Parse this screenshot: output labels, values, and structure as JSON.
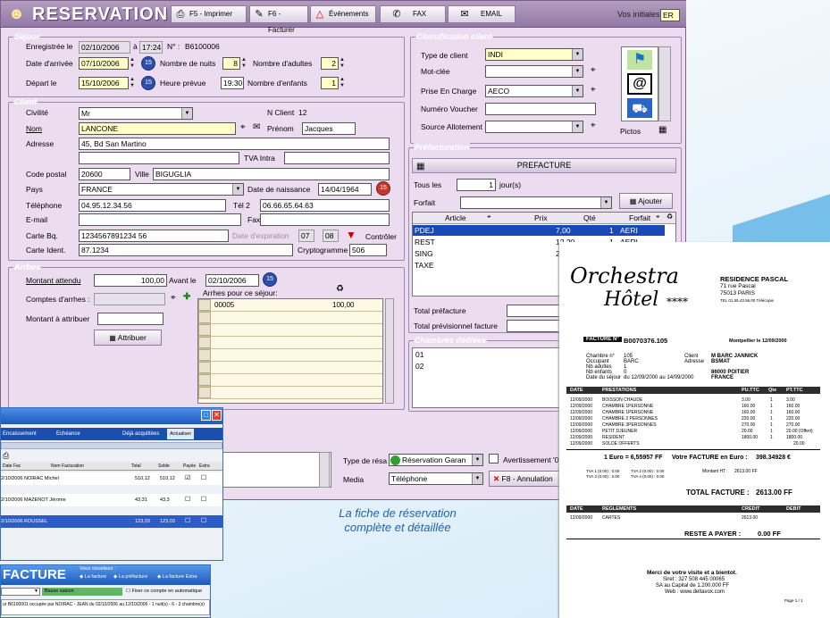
{
  "window": {
    "title": "RESERVATION",
    "toolbar": {
      "print": "F5 - Imprimer",
      "invoice": "F6 - Facturer",
      "events": "Événements",
      "fax": "FAX",
      "email": "EMAIL",
      "initials_label": "Vos initiales",
      "initials_value": "ER"
    }
  },
  "sejour": {
    "title": "Séjour",
    "recorded_label": "Enregistrée le",
    "recorded_date": "02/10/2006",
    "at": "à",
    "recorded_time": "17:24",
    "num_label": "N° :",
    "num_value": "B6100006",
    "arrival_label": "Date d'arrivée",
    "arrival_date": "07/10/2006",
    "nights_label": "Nombre de nuits",
    "nights": "8",
    "adults_label": "Nombre d'adultes",
    "adults": "2",
    "departure_label": "Départ le",
    "departure_date": "15/10/2006",
    "time_label": "Heure prévue",
    "time_value": "19:30",
    "children_label": "Nombre d'enfants",
    "children": "1"
  },
  "client": {
    "title": "Client",
    "civility_label": "Civilité",
    "civility": "Mr",
    "client_no_label": "N Client",
    "client_no": "12",
    "name_label": "Nom",
    "name": "LANCONE",
    "firstname_label": "Prénom",
    "firstname": "Jacques",
    "address_label": "Adresse",
    "address": "45, Bd San Martino",
    "vat_label": "TVA Intra",
    "postal_label": "Code postal",
    "postal": "20600",
    "city_label": "Ville",
    "city": "BIGUGLIA",
    "country_label": "Pays",
    "country": "FRANCE",
    "birth_label": "Date de naissance",
    "birth": "14/04/1964",
    "phone_label": "Téléphone",
    "phone": "04.95.12.34.56",
    "tel2_label": "Tél 2",
    "tel2": "06.66.65.64.63",
    "email_label": "E-mail",
    "fax_label": "Fax",
    "card_label": "Carte Bq.",
    "card": "1234567891234 56",
    "expiry_label": "Date d'expiration",
    "expiry_m": "07",
    "expiry_y": "08",
    "control": "Contrôler",
    "id_label": "Carte Ident.",
    "id": "87.1234",
    "crypto_label": "Cryptogramme",
    "crypto": "506"
  },
  "arrhes": {
    "title": "Arrhes",
    "expected_label": "Montant attendu",
    "expected": "100,00",
    "before_label": "Avant le",
    "before_date": "02/10/2006",
    "accounts_label": "Comptes d'arrhes :",
    "stay_label": "Arrhes pour ce séjour:",
    "grid": [
      {
        "ref": "00005",
        "amount": "100,00"
      }
    ],
    "assign_label": "Montant à attribuer",
    "assign_button": "Attribuer"
  },
  "classification": {
    "title": "Classification client",
    "type_label": "Type de client",
    "type": "INDI",
    "keyword_label": "Mot-clée",
    "pec_label": "Prise En Charge",
    "pec": "AECO",
    "voucher_label": "Numéro Voucher",
    "source_label": "Source Allotement",
    "pictos_label": "Pictos"
  },
  "prefacturation": {
    "title": "Préfacturation",
    "header": "PREFACTURE",
    "all_label": "Tous les",
    "every": "1",
    "unit": "jour(s)",
    "package_label": "Forfait",
    "add_button": "Ajouter",
    "columns": [
      "Article",
      "Prix",
      "Qté",
      "Forfait"
    ],
    "rows": [
      {
        "article": "PDEJ",
        "price": "7,00",
        "qty": "1",
        "forfait": "AERI"
      },
      {
        "article": "REST",
        "price": "12,20",
        "qty": "1",
        "forfait": "AERI"
      },
      {
        "article": "SING",
        "price": "2",
        "qty": "",
        "forfait": ""
      },
      {
        "article": "TAXE",
        "price": "",
        "qty": "",
        "forfait": ""
      }
    ],
    "total_label": "Total préfacture",
    "forecast_label": "Total prévisionnel facture"
  },
  "rooms": {
    "title": "Chambres dédiées",
    "list": [
      "01",
      "02"
    ]
  },
  "bottom": {
    "type_label": "Type de résa",
    "type_value": "Réservation Garan",
    "notice": "Avertissement '0",
    "media_label": "Media",
    "media_value": "Téléphone",
    "cancel": "F8 - Annulation"
  },
  "caption": {
    "line1": "La fiche de réservation",
    "line2": "complète et détaillée"
  },
  "invoice": {
    "logo1": "Orchestra",
    "logo2": "Hôtel",
    "stars": "****",
    "hotel": "RESIDENCE PASCAL",
    "street": "71 rue Pascal",
    "city": "75013 PARIS",
    "tel": "TEL 01.55.43.56.00 Télécopie",
    "facture_label": "FACTURE N°",
    "facture_no": "B0070376.105",
    "place_date": "Montpellier le 12/09/2000",
    "room_label": "Chambre n°",
    "room": "105",
    "occupant_label": "Occupant",
    "occupant": "BARC",
    "adults_label": "Nb adultes",
    "adults": "1",
    "children_label": "Nb enfants",
    "children": "0",
    "stay_label": "Date du séjour",
    "stay": "du 12/09/2000 au 14/09/2000",
    "client_label": "Client",
    "client": "M BARC JANNICK",
    "address_label": "Adresse",
    "address": "BSMAT",
    "address2": "86000 POITIER",
    "address3": "FRANCE",
    "cols": [
      "DATE",
      "PRESTATIONS",
      "PU.TTC",
      "Qte",
      "PT.TTC"
    ],
    "lines": [
      {
        "date": "12/09/2000",
        "label": "BOISSON CHAUDE",
        "pu": "3.00",
        "qte": "1",
        "pt": "3.00"
      },
      {
        "date": "12/09/2000",
        "label": "CHAMBRE 1PERSONNE",
        "pu": "160.00",
        "qte": "1",
        "pt": "160.00"
      },
      {
        "date": "12/09/2000",
        "label": "CHAMBRE 1PERSONNE",
        "pu": "160.00",
        "qte": "1",
        "pt": "160.00"
      },
      {
        "date": "12/09/2000",
        "label": "CHAMBRE 2 PERSONNES",
        "pu": "220.00",
        "qte": "1",
        "pt": "220.00"
      },
      {
        "date": "12/09/2000",
        "label": "CHAMBRE 3PERSONNES",
        "pu": "270.00",
        "qte": "1",
        "pt": "270.00"
      },
      {
        "date": "12/09/2000",
        "label": "PETIT DJEUNER",
        "pu": "20.00",
        "qte": "1",
        "pt": "20.00 (Offert)"
      },
      {
        "date": "12/09/2000",
        "label": "RESIDENT",
        "pu": "1800.00",
        "qte": "1",
        "pt": "1800.00"
      },
      {
        "date": "12/09/2000",
        "label": "SOLDE OFFERTS",
        "pu": "",
        "qte": "",
        "pt": "20.00"
      }
    ],
    "euro_rate": "1 Euro = 6,55957 FF",
    "euro_label": "Votre FACTURE en Euro :",
    "euro_total": "398.34928 €",
    "tva1": "TVA 1 (0.00) : 0.00",
    "tva2": "TVA 2 (0.00) : 0.00",
    "tva3": "TVA 3 (0.00) : 0.00",
    "tva4": "TVA 4 (0.00) : 0.00",
    "ht_label": "Montant HT :",
    "ht": "2613.00 FF",
    "total_label": "TOTAL FACTURE :",
    "total": "2613.00 FF",
    "reg_cols": [
      "DATE",
      "REGLEMENTS",
      "CREDIT",
      "DEBIT"
    ],
    "reg_date": "12/09/2000",
    "reg_label": "CARTES",
    "reg_credit": "2613.00",
    "rest_label": "RESTE A PAYER :",
    "rest": "0.00 FF",
    "thanks": "Merci de votre visite et a bientot.",
    "siret": "Siret : 327 508 445 00065",
    "capital": "SA au Capital de 1.200.000 FF",
    "web": "Web : www.deltavox.com",
    "page": "Page 1 / 1"
  },
  "window2": {
    "opt1": "Encaissement",
    "opt2": "Echéance",
    "opt3": "Déjà acquittées",
    "button": "Actualiser",
    "cols": [
      "Date Fac",
      "Nom Facturation",
      "Total",
      "Solde",
      "Payée",
      "Extra"
    ],
    "rows": [
      {
        "date": "2/10/2006",
        "name": "NOIRAC Michel",
        "total": "510,12",
        "solde": "510,12"
      },
      {
        "date": "2/10/2006",
        "name": "MAZENOT Jérome",
        "total": "43,31",
        "solde": "43,3"
      },
      {
        "date": "2/10/2006",
        "name": "ROUSSEL",
        "total": "123,03",
        "solde": "123,03"
      }
    ]
  },
  "window3": {
    "title": "FACTURE",
    "viewing": "Vous visualisez :",
    "opt1": "La facture",
    "opt2": "La préfacture",
    "opt3": "La facture Extra",
    "search_value": "Basse saison",
    "auto_label": "Fixer ce compte en automatique",
    "note": "ur B6100001 occupée par NOIRAC - JEAN du 02/10/2006 au 12/10/2006 - 1 nuit(s) - 6 - 3 chambre(s)"
  }
}
